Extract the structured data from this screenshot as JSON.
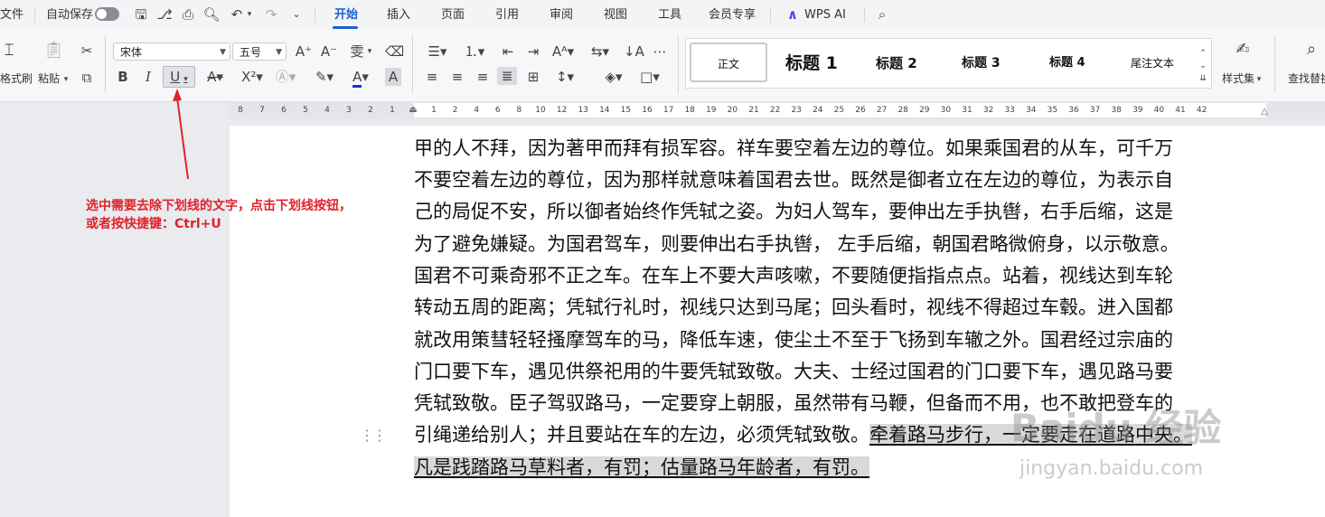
{
  "menubar": {
    "file": "文件",
    "autosave": "自动保存",
    "tabs": [
      "开始",
      "插入",
      "页面",
      "引用",
      "审阅",
      "视图",
      "工具",
      "会员专享"
    ],
    "wps_ai": "WPS AI"
  },
  "ribbon": {
    "format_painter": "格式刷",
    "paste": "粘贴",
    "font_name": "宋体",
    "font_size": "五号",
    "styles": [
      "正文",
      "标题 1",
      "标题 2",
      "标题 3",
      "标题 4",
      "尾注文本"
    ],
    "style_set": "样式集",
    "find_replace": "查找替换"
  },
  "ruler": {
    "left_ticks": [
      "8",
      "7",
      "6",
      "5",
      "4",
      "3",
      "2",
      "1"
    ],
    "right_ticks": [
      "1",
      "2",
      "4",
      "6",
      "8",
      "10",
      "12",
      "13",
      "14",
      "15",
      "16",
      "17",
      "18",
      "19",
      "20",
      "21",
      "22",
      "23",
      "24",
      "25",
      "26",
      "27",
      "28",
      "29",
      "30",
      "31",
      "32",
      "33",
      "34",
      "35",
      "36",
      "37",
      "38",
      "39",
      "40",
      "41",
      "42"
    ]
  },
  "document": {
    "lines": [
      "甲的人不拜，因为著甲而拜有损军容。祥车要空着左边的尊位。如果乘国君的从车，可千万",
      "不要空着左边的尊位，因为那样就意味着国君去世。既然是御者立在左边的尊位，为表示自",
      "己的局促不安，所以御者始终作凭轼之姿。为妇人驾车，要伸出左手执辔，右手后缩，这是",
      "为了避免嫌疑。为国君驾车，则要伸出右手执辔， 左手后缩，朝国君略微俯身，以示敬意。",
      "国君不可乘奇邪不正之车。在车上不要大声咳嗽，不要随便指指点点。站着，视线达到车轮",
      "转动五周的距离；凭轼行礼时，视线只达到马尾；回头看时，视线不得超过车毂。进入国都",
      "就改用策彗轻轻搔摩驾车的马，降低车速，使尘土不至于飞扬到车辙之外。国君经过宗庙的",
      "门口要下车，遇见供祭祀用的牛要凭轼致敬。大夫、士经过国君的门口要下车，遇见路马要",
      "凭轼致敬。臣子驾驭路马，一定要穿上朝服，虽然带有马鞭，但备而不用，也不敢把登车的"
    ],
    "line10_plain": "引绳递给别人；并且要站在车的左边，必须凭轼致敬。",
    "line10_selected": "牵着路马步行，一定要走在道路中央。",
    "line11_selected": "凡是践踏路马草料者，有罚；估量路马年龄者，有罚。"
  },
  "annotation": {
    "line1": "选中需要去除下划线的文字，点击下划线按钮，",
    "line2": "或者按快捷键：Ctrl+U"
  },
  "watermark": {
    "brand": "Baidu 经验",
    "url": "jingyan.baidu.com"
  },
  "colors": {
    "accent": "#1a5fd1",
    "annotation": "#e0222a",
    "selection": "#d9d9d9"
  }
}
